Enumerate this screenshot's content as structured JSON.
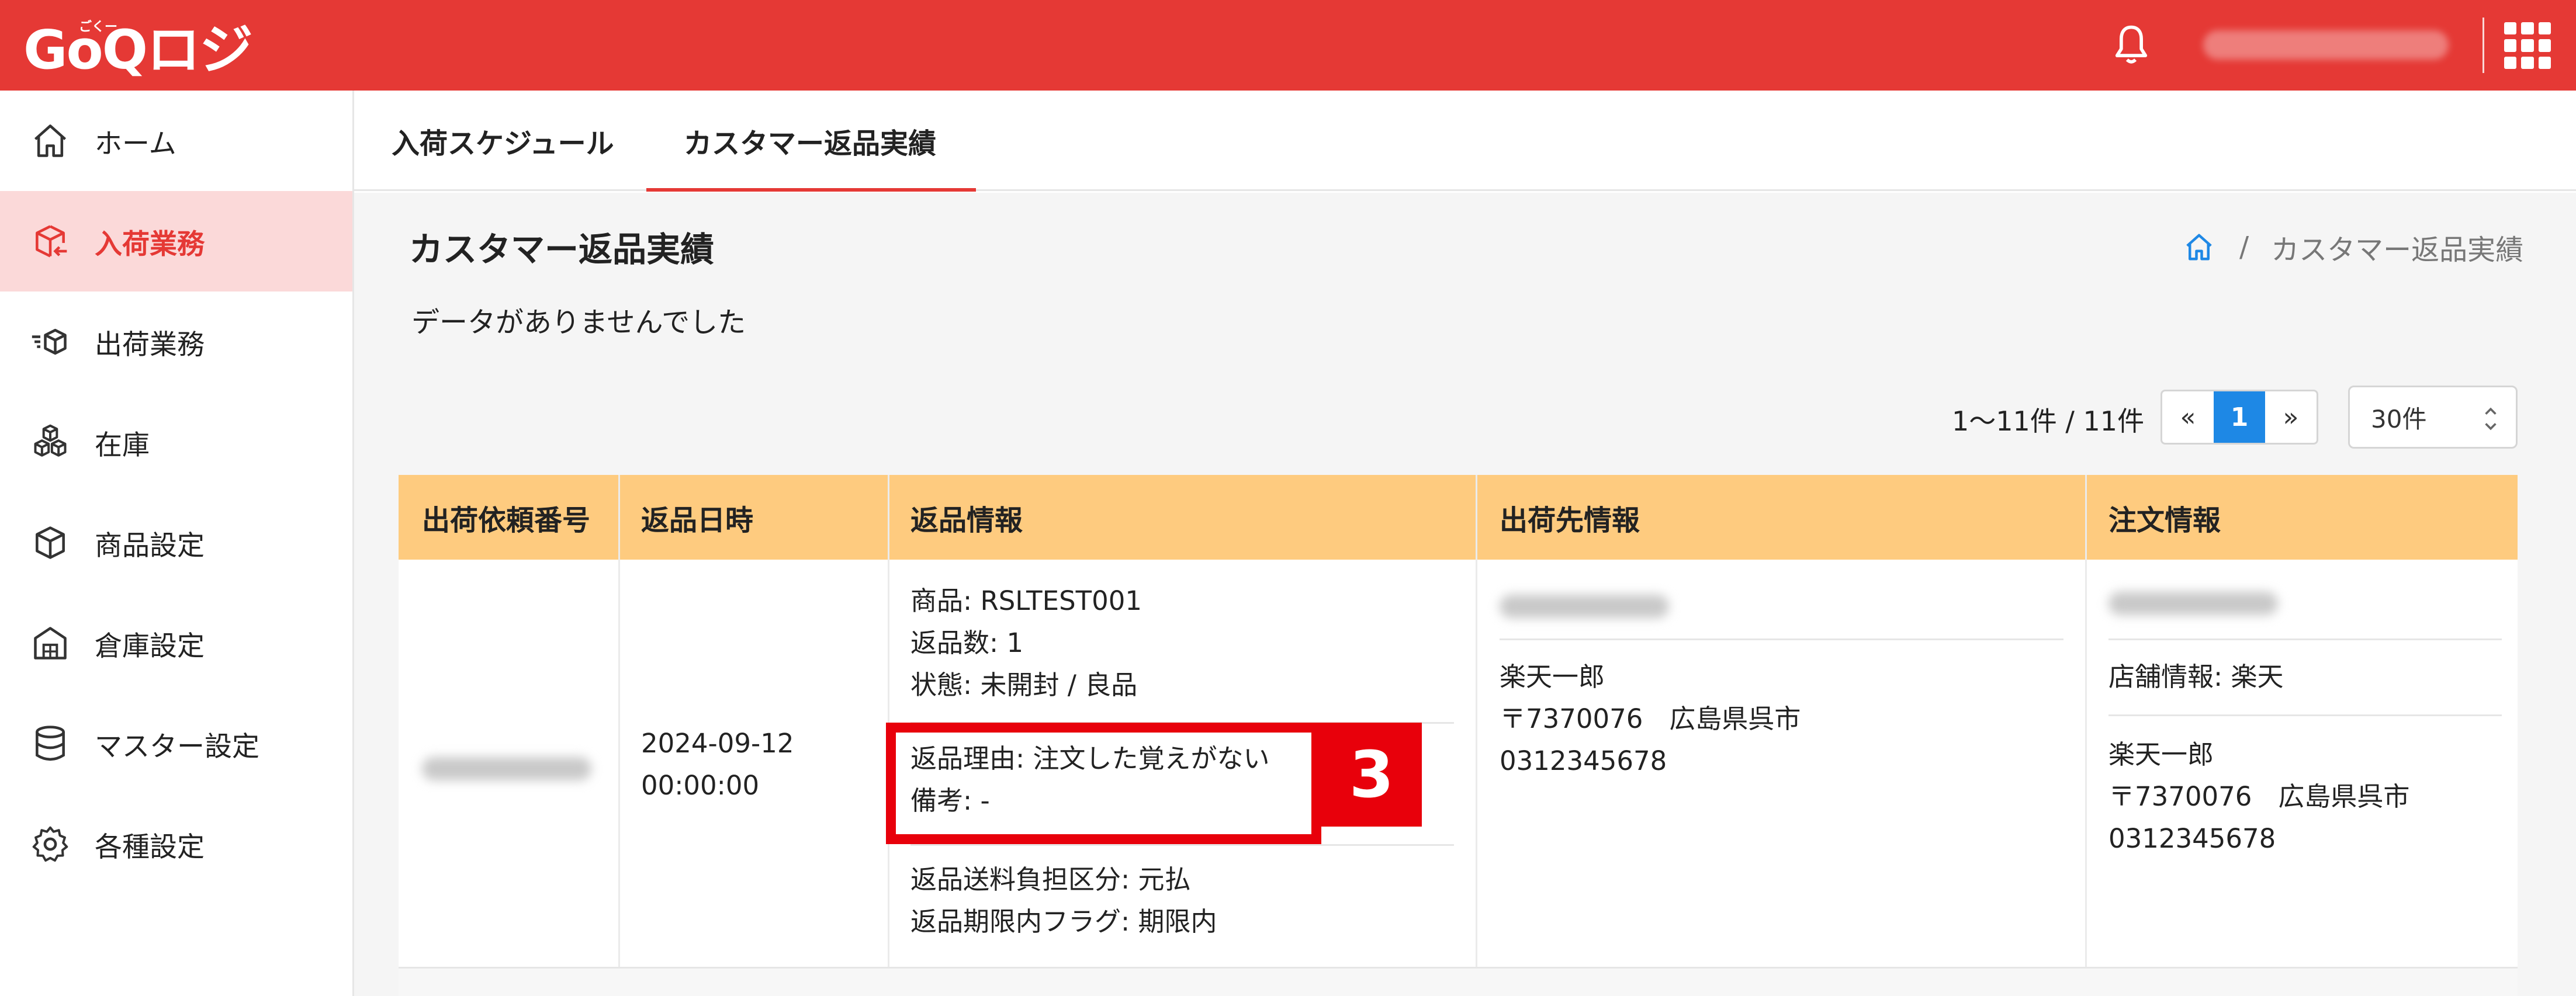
{
  "header": {
    "logo": "GoQロジ",
    "logo_ruby": "ごくー"
  },
  "tabs": [
    {
      "label": "入荷スケジュール",
      "active": false
    },
    {
      "label": "カスタマー返品実績",
      "active": true
    }
  ],
  "sidebar": {
    "items": [
      {
        "label": "ホーム",
        "icon": "home-icon",
        "active": false
      },
      {
        "label": "入荷業務",
        "icon": "inbound-box-icon",
        "active": true
      },
      {
        "label": "出荷業務",
        "icon": "outbound-box-icon",
        "active": false
      },
      {
        "label": "在庫",
        "icon": "stock-boxes-icon",
        "active": false
      },
      {
        "label": "商品設定",
        "icon": "product-box-icon",
        "active": false
      },
      {
        "label": "倉庫設定",
        "icon": "warehouse-icon",
        "active": false
      },
      {
        "label": "マスター設定",
        "icon": "database-icon",
        "active": false
      },
      {
        "label": "各種設定",
        "icon": "gear-icon",
        "active": false
      }
    ]
  },
  "page": {
    "title": "カスタマー返品実績",
    "breadcrumb_sep": "/",
    "breadcrumb_current": "カスタマー返品実績",
    "no_data": "データがありませんでした"
  },
  "pagination": {
    "count": "1〜11件 / 11件",
    "prev": "«",
    "current": "1",
    "next": "»",
    "per_page": "30件"
  },
  "table": {
    "headers": [
      "出荷依頼番号",
      "返品日時",
      "返品情報",
      "出荷先情報",
      "注文情報"
    ],
    "row": {
      "return_date": "2024-09-12",
      "return_time": "00:00:00",
      "return_info": {
        "product": "商品: RSLTEST001",
        "quantity": "返品数: 1",
        "condition": "状態: 未開封 / 良品",
        "reason": "返品理由: 注文した覚えがない",
        "note": "備考: -",
        "shipping_fee": "返品送料負担区分: 元払",
        "deadline_flag": "返品期限内フラグ: 期限内"
      },
      "ship_to": {
        "name": "楽天一郎",
        "address": "〒7370076　広島県呉市",
        "phone": "0312345678"
      },
      "order_info": {
        "store": "店舗情報: 楽天",
        "name": "楽天一郎",
        "address": "〒7370076　広島県呉市",
        "phone": "0312345678"
      }
    }
  },
  "annotation": {
    "badge": "3"
  },
  "colors": {
    "brand_red": "#e53935",
    "table_header": "#fecb7f",
    "active_nav_bg": "#fbd9d9",
    "pager_active": "#1e88e5",
    "highlight": "#e8000b"
  }
}
